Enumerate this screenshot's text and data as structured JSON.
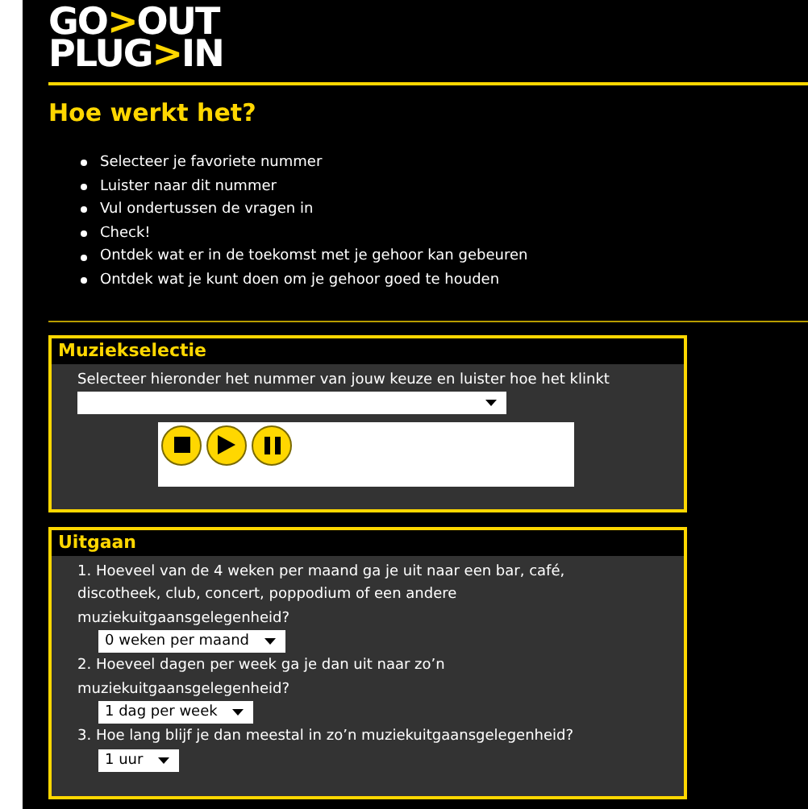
{
  "logo": {
    "lines": [
      {
        "before": "GO",
        "arrow": ">",
        "after": "OUT"
      },
      {
        "before": "PLUG",
        "arrow": ">",
        "after": "IN"
      }
    ]
  },
  "intro": {
    "title": "Hoe werkt het?",
    "steps": [
      "Selecteer je favoriete nummer",
      "Luister naar dit nummer",
      "Vul ondertussen de vragen in",
      "Check!",
      "Ontdek wat er in de toekomst met je gehoor kan gebeuren",
      "Ontdek wat je kunt doen om je gehoor goed te houden"
    ]
  },
  "music": {
    "title": "Muziekselectie",
    "instruction": "Selecteer hieronder het nummer van jouw keuze en luister hoe het klinkt",
    "player": {
      "buttons": [
        {
          "kind": "stop"
        },
        {
          "kind": "play"
        },
        {
          "kind": "pause"
        }
      ]
    }
  },
  "going_out": {
    "title": "Uitgaan",
    "questions": [
      {
        "text": "1. Hoeveel van de 4 weken per maand ga je uit naar een bar, café, discotheek, club, concert, poppodium of een andere muziekuitgaansgelegenheid?",
        "answer": "0 weken per maand"
      },
      {
        "text": "2. Hoeveel dagen per week ga je dan uit naar zo’n muziekuitgaansgelegenheid?",
        "answer": "1 dag per week"
      },
      {
        "text": "3. Hoe lang blijf je dan meestal in zo’n muziekuitgaansgelegenheid?",
        "answer": "1 uur"
      }
    ]
  }
}
